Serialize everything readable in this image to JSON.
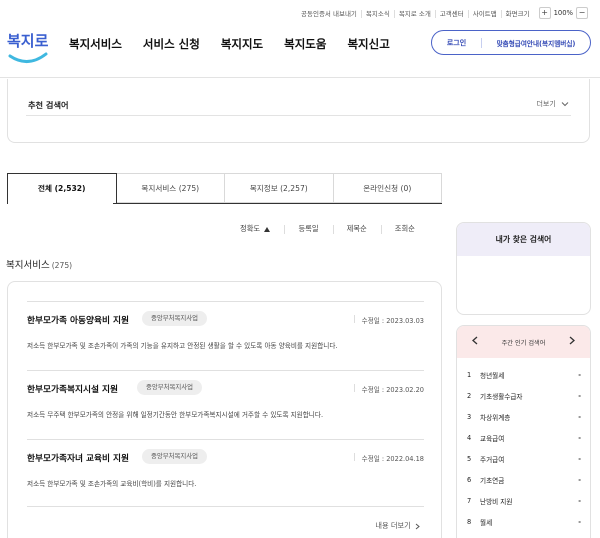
{
  "utility_bar": {
    "links": [
      "공동인증서 내보내기",
      "복지소식",
      "복지로 소개",
      "고객센터",
      "사이트맵"
    ],
    "zoom_label": "화면크기",
    "zoom_minus": "−",
    "zoom_plus": "+",
    "zoom_value": "100%"
  },
  "header": {
    "logo_text": "복지로",
    "brand_color": "#3a5fd0",
    "nav": [
      "복지서비스",
      "서비스 신청",
      "복지지도",
      "복지도움",
      "복지신고"
    ],
    "login_label": "로그인",
    "custom_benefit_label": "맞춤형급여안내(복지멤버십)"
  },
  "recommended": {
    "title": "추천 검색어",
    "more_label": "더보기"
  },
  "tabs": [
    {
      "label": "전체 (2,532)",
      "active": true
    },
    {
      "label": "복지서비스 (275)",
      "active": false
    },
    {
      "label": "복지정보 (2,257)",
      "active": false
    },
    {
      "label": "온라인신청 (0)",
      "active": false
    }
  ],
  "sort": [
    {
      "label": "정확도",
      "active": true,
      "icon": "sort-up-icon"
    },
    {
      "label": "등록일",
      "active": false
    },
    {
      "label": "제목순",
      "active": false
    },
    {
      "label": "조회순",
      "active": false
    }
  ],
  "section": {
    "title": "복지서비스",
    "count": "(275)"
  },
  "results": [
    {
      "title": "한부모가족 아동양육비 지원",
      "badge": "중앙부처복지사업",
      "date": "수정일 : 2023.03.03",
      "desc": "저소득 한부모가족 및 조손가족이 가족의 기능을 유지하고 안정된 생활을 할 수 있도록 아동 양육비를 지원합니다."
    },
    {
      "title": "한부모가족복지시설 지원",
      "badge": "중앙부처복지사업",
      "date": "수정일 : 2023.02.20",
      "desc": "저소득 무주택 한부모가족의 안정을 위해 일정기간동안 한부모가족복지시설에 거주할 수 있도록 지원합니다."
    },
    {
      "title": "한부모가족자녀 교육비 지원",
      "badge": "중앙부처복지사업",
      "date": "수정일 : 2022.04.18",
      "desc": "저소득 한부모가족 및 조손가족의 교육비(학비)를 지원합니다."
    }
  ],
  "results_more": "내용 더보기",
  "my_search": {
    "title": "내가 찾은 검색어"
  },
  "popular": {
    "title": "주간 인기 검색어",
    "items": [
      {
        "rank": "1",
        "keyword": "청년월세",
        "change": "-"
      },
      {
        "rank": "2",
        "keyword": "기초생활수급자",
        "change": "-"
      },
      {
        "rank": "3",
        "keyword": "차상위계층",
        "change": "-"
      },
      {
        "rank": "4",
        "keyword": "교육급여",
        "change": "-"
      },
      {
        "rank": "5",
        "keyword": "주거급여",
        "change": "-"
      },
      {
        "rank": "6",
        "keyword": "기초연금",
        "change": "-"
      },
      {
        "rank": "7",
        "keyword": "난방비 지원",
        "change": "-"
      },
      {
        "rank": "8",
        "keyword": "월세",
        "change": "-"
      }
    ]
  }
}
